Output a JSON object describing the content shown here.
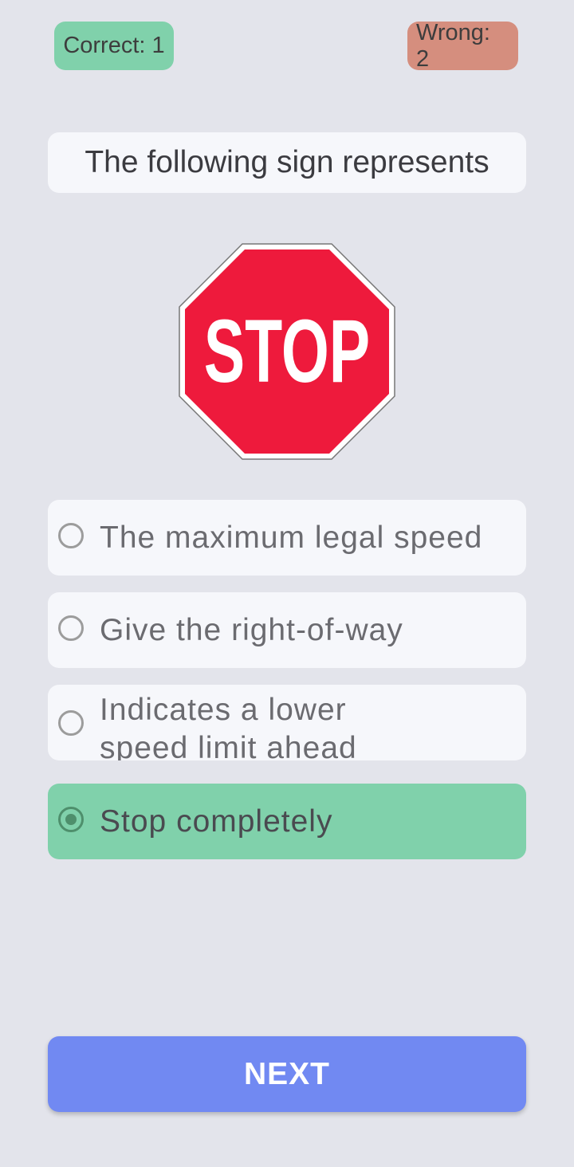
{
  "score": {
    "correct_label": "Correct: 1",
    "wrong_label": "Wrong: 2"
  },
  "question": {
    "text": "The following sign represents"
  },
  "sign": {
    "text": "STOP",
    "icon": "stop-sign-icon",
    "fill_color": "#ee1a3c",
    "border_color": "#ffffff"
  },
  "options": [
    {
      "label": "The maximum legal speed",
      "selected": false
    },
    {
      "label": "Give the right-of-way",
      "selected": false
    },
    {
      "label": "Indicates a lower speed limit ahead",
      "selected": false
    },
    {
      "label": "Stop completely",
      "selected": true
    }
  ],
  "next_button": {
    "label": "NEXT"
  },
  "colors": {
    "background": "#e3e4eb",
    "correct_badge": "#80d1ab",
    "wrong_badge": "#d58e7e",
    "selected_option": "#80d1ab",
    "option_background": "#f6f7fb",
    "next_button": "#7189f2"
  }
}
